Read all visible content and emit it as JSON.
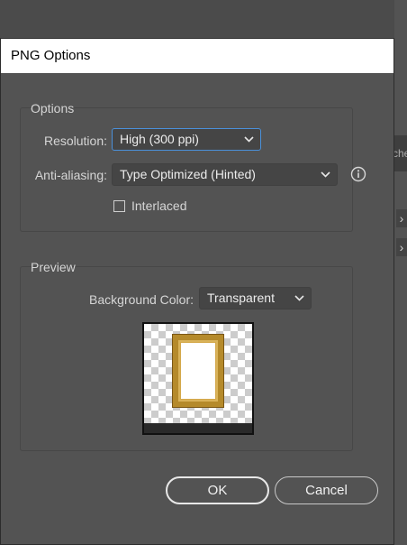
{
  "dialog": {
    "title": "PNG Options",
    "options_group": {
      "title": "Options",
      "resolution": {
        "label": "Resolution:",
        "value": "High (300 ppi)"
      },
      "anti_aliasing": {
        "label": "Anti-aliasing:",
        "value": "Type Optimized (Hinted)"
      },
      "interlaced": {
        "label": "Interlaced",
        "checked": false
      }
    },
    "preview_group": {
      "title": "Preview",
      "background_color": {
        "label": "Background Color:",
        "value": "Transparent"
      }
    },
    "buttons": {
      "ok": "OK",
      "cancel": "Cancel"
    }
  },
  "background_app": {
    "tab_text": "che"
  },
  "colors": {
    "dialog_bg": "#535353",
    "focus": "#4a90d9",
    "frame_gold": "#b58a2b"
  }
}
